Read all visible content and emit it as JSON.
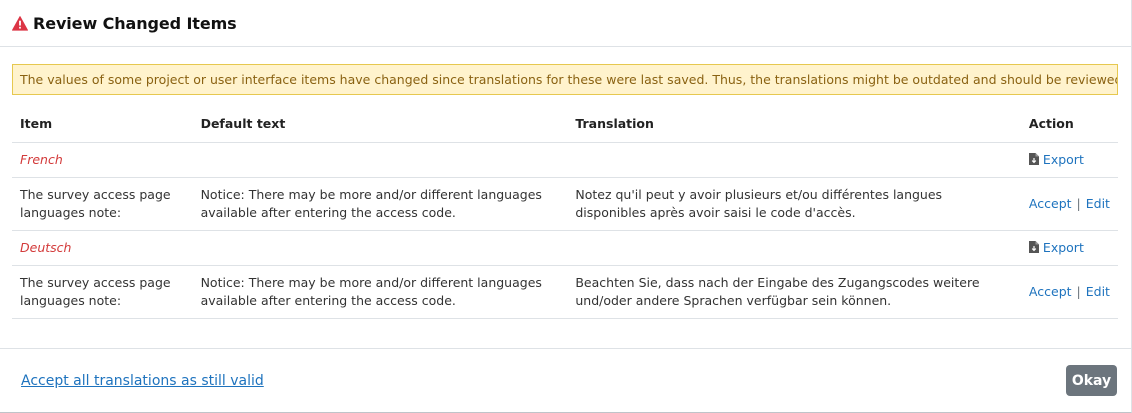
{
  "dialog": {
    "title": "Review Changed Items",
    "alert": "The values of some project or user interface items have changed since translations for these were last saved. Thus, the translations might be outdated and should be reviewed."
  },
  "table": {
    "headers": {
      "item": "Item",
      "default_text": "Default text",
      "translation": "Translation",
      "action": "Action"
    },
    "groups": [
      {
        "language": "French",
        "export_label": "Export",
        "rows": [
          {
            "item": "The survey access page languages note:",
            "default_text": "Notice: There may be more and/or different languages available after entering the access code.",
            "translation": "Notez qu'il peut y avoir plusieurs et/ou différentes langues disponibles après avoir saisi le code d'accès.",
            "accept_label": "Accept",
            "separator": "|",
            "edit_label": "Edit"
          }
        ]
      },
      {
        "language": "Deutsch",
        "export_label": "Export",
        "rows": [
          {
            "item": "The survey access page languages note:",
            "default_text": "Notice: There may be more and/or different languages available after entering the access code.",
            "translation": "Beachten Sie, dass nach der Eingabe des Zugangscodes weitere und/oder andere Sprachen verfügbar sein können.",
            "accept_label": "Accept",
            "separator": "|",
            "edit_label": "Edit"
          }
        ]
      }
    ]
  },
  "footer": {
    "accept_all_label": "Accept all translations as still valid",
    "okay_label": "Okay"
  },
  "icons": {
    "warning": "warning-triangle-icon",
    "export": "file-download-icon"
  },
  "colors": {
    "warning_icon": "#dc3545",
    "language_label": "#d33a3a",
    "link": "#1e73be",
    "alert_bg": "#fff3cd",
    "alert_border": "#e6c84f",
    "alert_text": "#8a6212",
    "okay_button_bg": "#6c757d"
  }
}
